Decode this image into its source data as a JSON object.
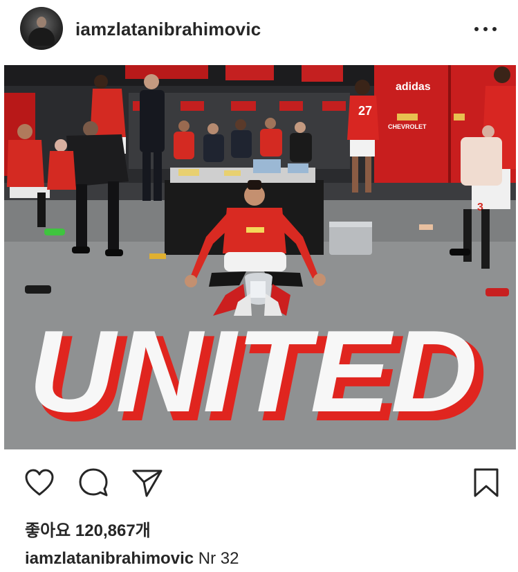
{
  "post": {
    "username": "iamzlatanibrahimovic",
    "more_icon": "more-horizontal-icon",
    "image": {
      "floor_text": "UNITED",
      "adidas_text": "adidas",
      "sponsor_text": "CHEVROLET",
      "shirt_number_1": "27",
      "shirt_number_2": "3"
    },
    "actions": {
      "like_icon": "heart-icon",
      "comment_icon": "comment-icon",
      "share_icon": "send-icon",
      "save_icon": "bookmark-icon"
    },
    "likes_label": "좋아요 120,867개",
    "caption": {
      "user": "iamzlatanibrahimovic",
      "text": "Nr 32"
    }
  },
  "colors": {
    "text": "#262626",
    "united_red": "#e0251f",
    "floor": "#8f9192"
  }
}
